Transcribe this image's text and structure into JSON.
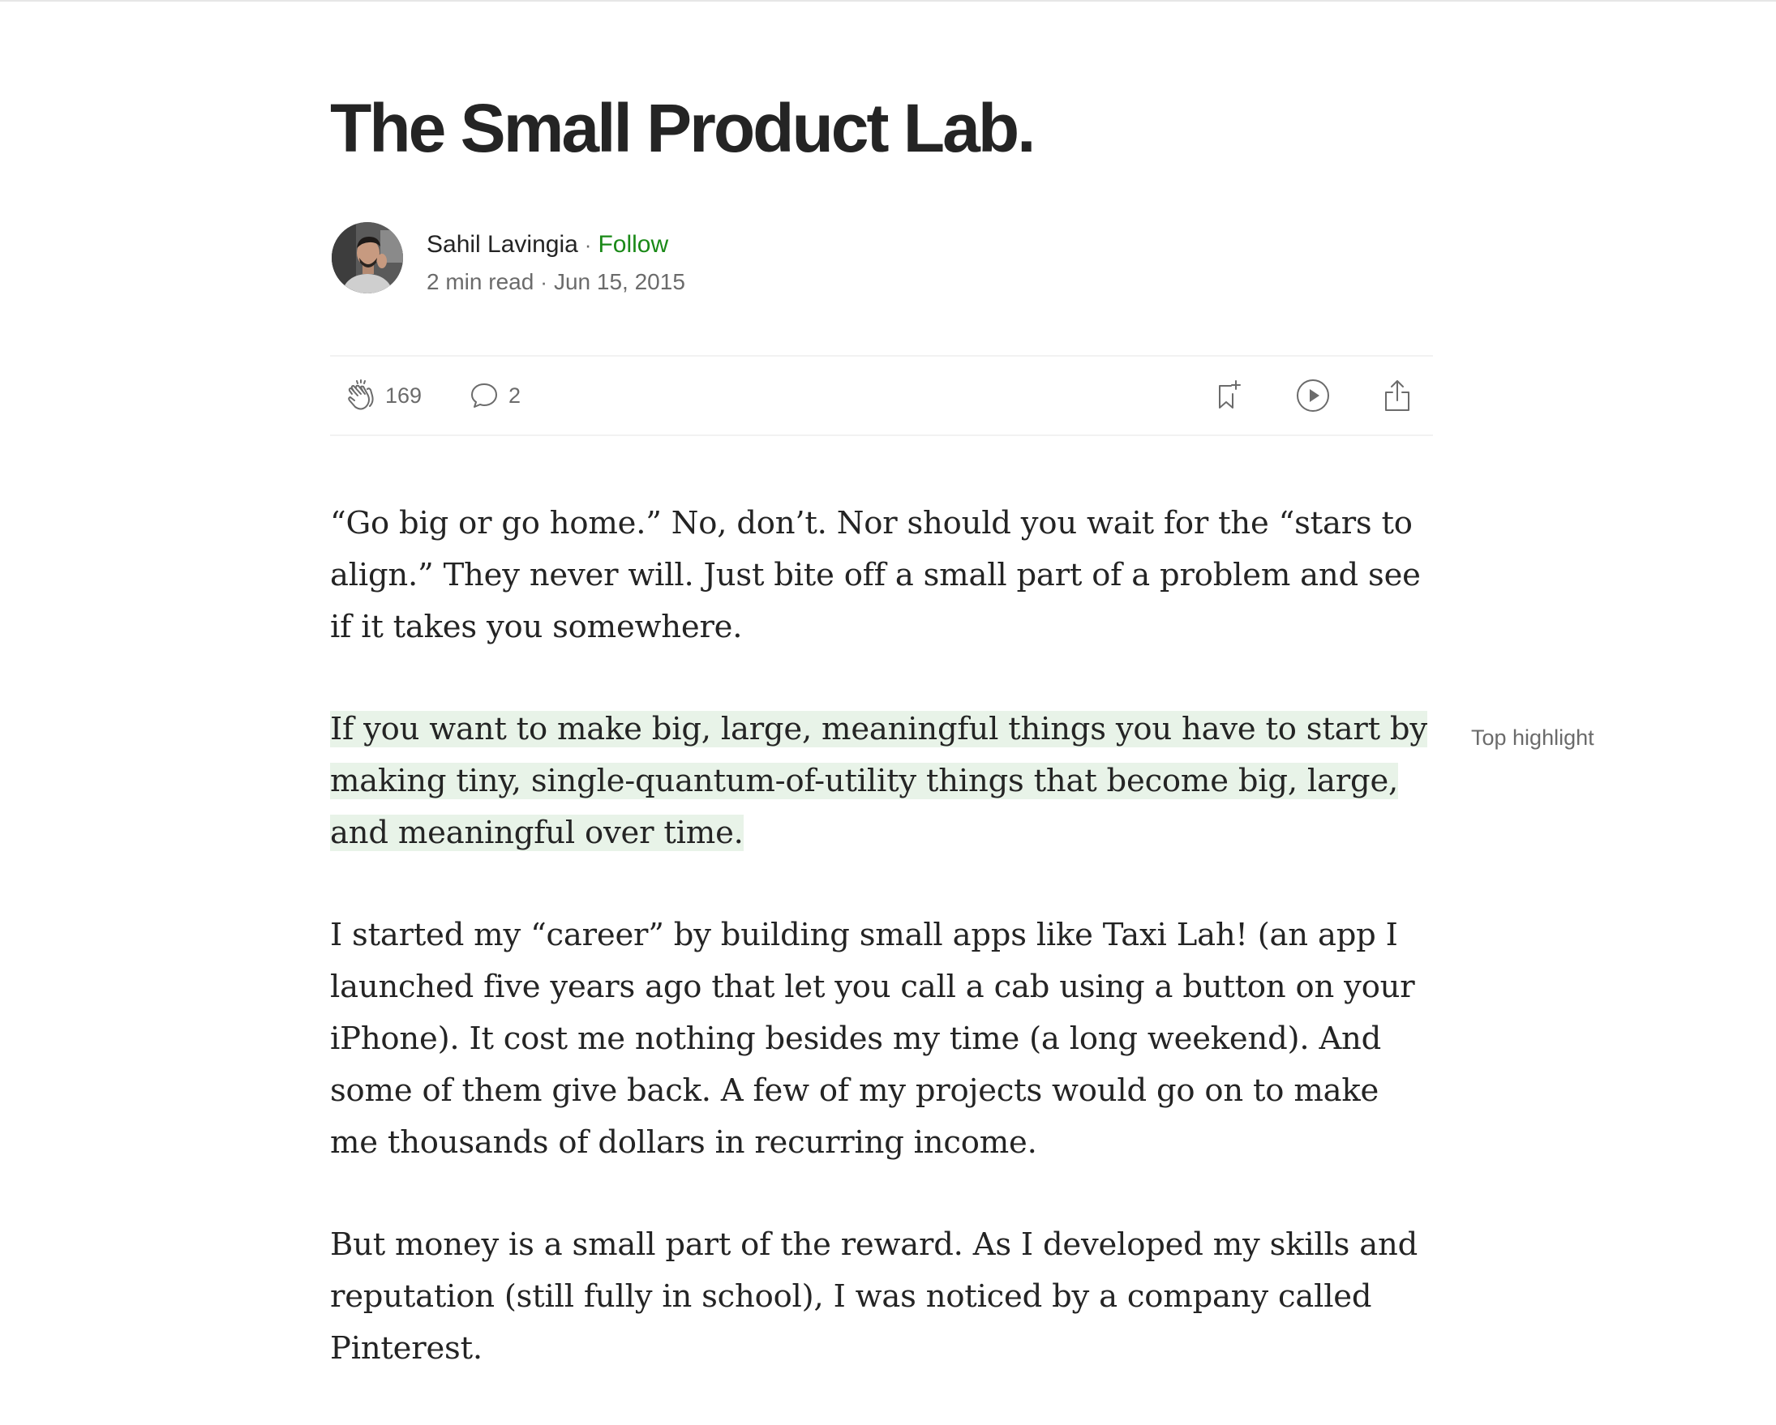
{
  "article": {
    "title": "The Small Product Lab.",
    "author": "Sahil Lavingia",
    "follow_label": "Follow",
    "read_time": "2 min read",
    "date": "Jun 15, 2015",
    "separator": "·"
  },
  "actions": {
    "claps": "169",
    "responses": "2",
    "icons": [
      "clap-icon",
      "response-icon",
      "bookmark-add-icon",
      "play-icon",
      "share-icon"
    ]
  },
  "highlight": {
    "label": "Top highlight",
    "color": "#e8f3e8"
  },
  "body": {
    "p1": "“Go big or go home.” No, don’t. Nor should you wait for the “stars to align.” They never will. Just bite off a small part of a problem and see if it takes you somewhere.",
    "p2": "If you want to make big, large, meaningful things you have to start by making tiny, single-quantum-of-utility things that become big, large, and meaningful over time.",
    "p3": "I started my “career” by building small apps like Taxi Lah! (an app I launched five years ago that let you call a cab using a button on your iPhone). It cost me nothing besides my time (a long weekend). And some of them give back. A few of my projects would go on to make me thousands of dollars in recurring income.",
    "p4": "But money is a small part of the reward. As I developed my skills and reputation (still fully in school), I was noticed by a company called Pinterest."
  },
  "colors": {
    "text": "#242424",
    "muted": "#6b6b6b",
    "follow": "#1a8917"
  }
}
